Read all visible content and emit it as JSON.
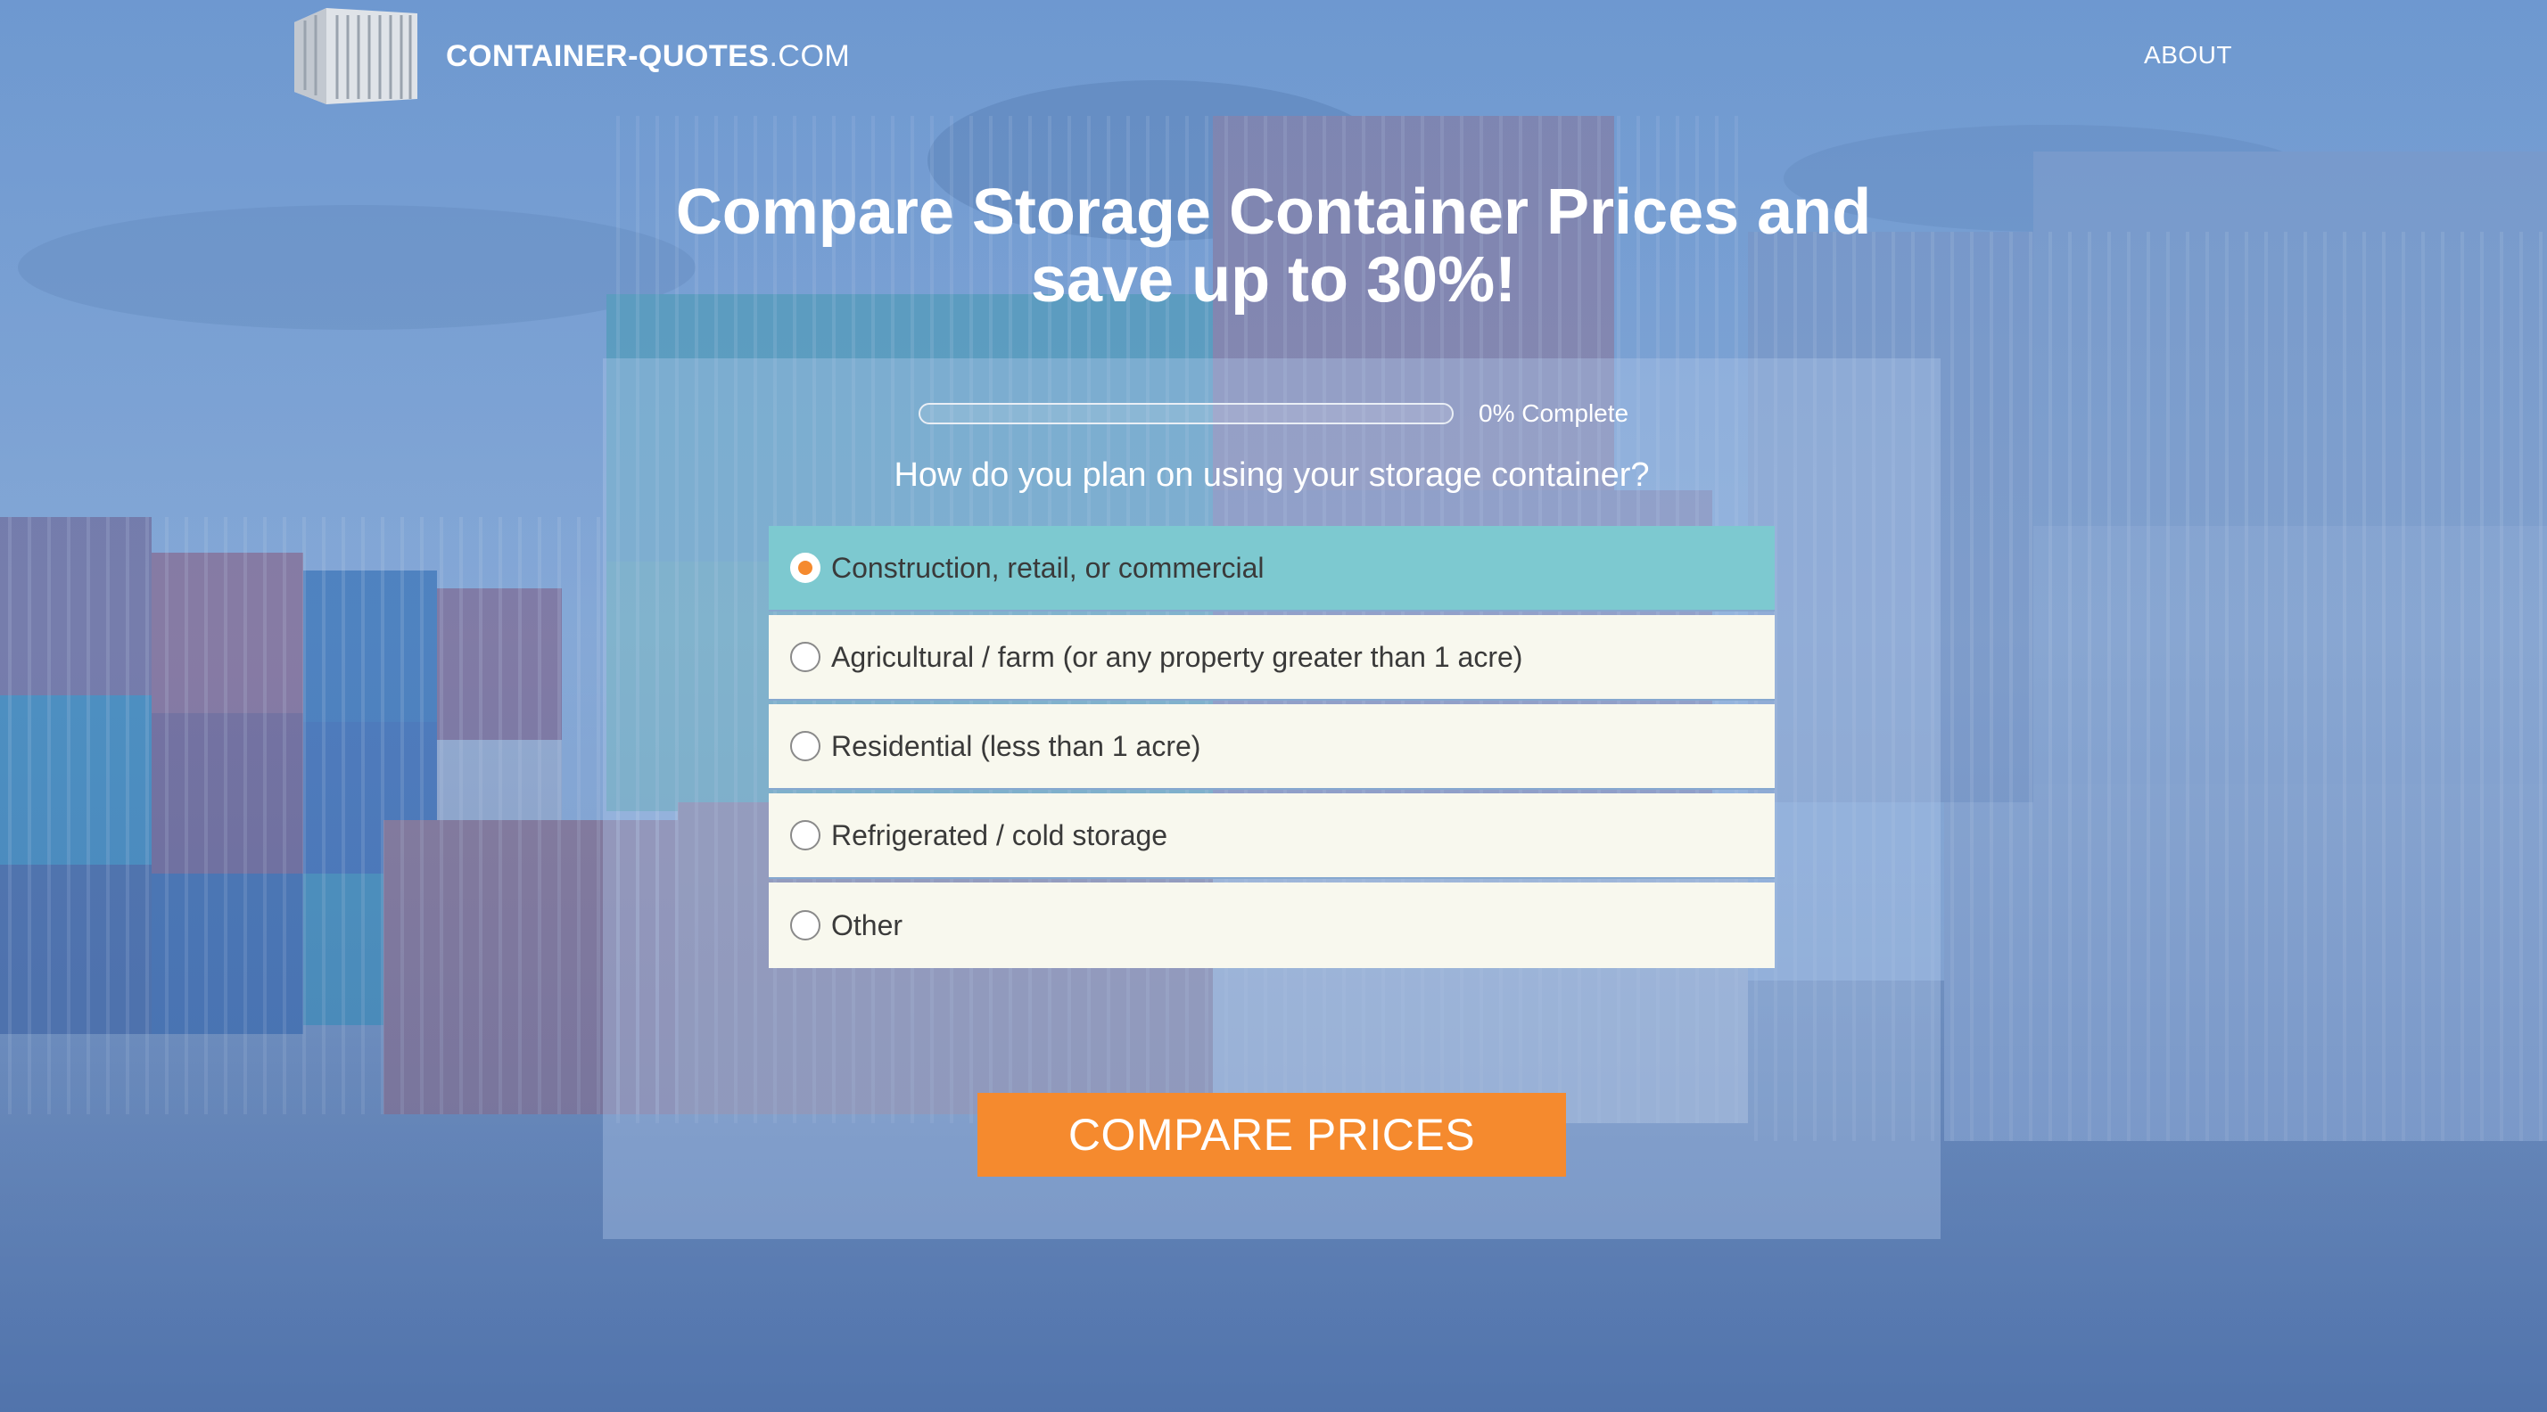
{
  "header": {
    "logo_text_bold": "CONTAINER-QUOTES",
    "logo_text_suffix": ".COM",
    "logo_icon": "shipping-container-icon",
    "nav_about": "ABOUT"
  },
  "hero": {
    "headline_line1": "Compare Storage Container Prices and",
    "headline_line2": "save up to 30%!"
  },
  "form": {
    "progress_percent": 0,
    "progress_label": "0% Complete",
    "question": "How do you plan on using your storage container?",
    "options": [
      {
        "label": "Construction, retail, or commercial",
        "selected": true
      },
      {
        "label": "Agricultural / farm (or any property greater than 1 acre)",
        "selected": false
      },
      {
        "label": "Residential (less than 1 acre)",
        "selected": false
      },
      {
        "label": "Refrigerated / cold storage",
        "selected": false
      },
      {
        "label": "Other",
        "selected": false
      }
    ],
    "submit_label": "COMPARE PRICES"
  },
  "colors": {
    "accent": "#f58a2e",
    "selected_option": "#7dc9d0",
    "option_background": "#f8f8ee"
  }
}
